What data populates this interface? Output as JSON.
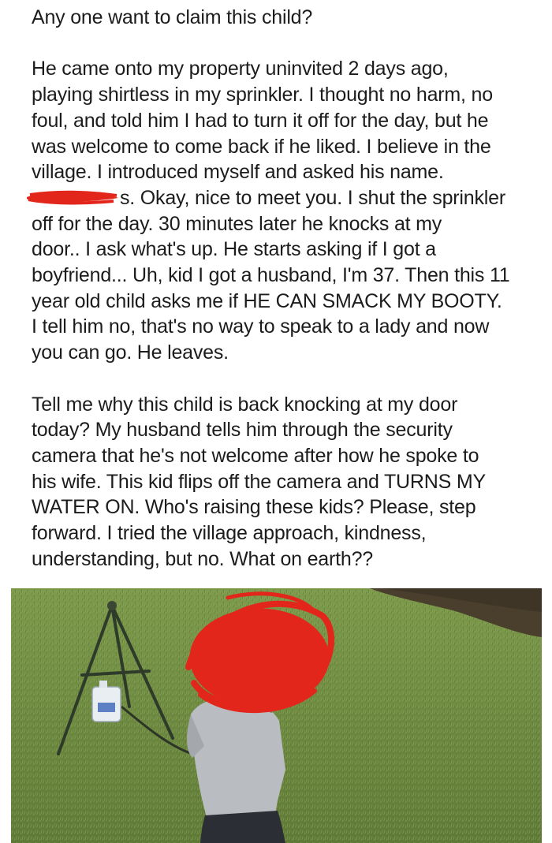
{
  "post": {
    "title": "Any one want to claim this child?",
    "paragraphs": [
      {
        "lines": [
          "He came onto my property uninvited 2  days ago,",
          "playing shirtless in my sprinkler. I thought no harm, no",
          "foul, and told him I had to turn it off for the day, but he",
          "was welcome to come back if he liked. I believe in the",
          "village. I introduced myself and asked his name.",
          "s. Okay, nice to meet you. I shut the sprinkler",
          "off for the day. 30 minutes later he knocks at my",
          "door.. I ask what's up. He starts asking if I got a",
          "boyfriend... Uh, kid I got a husband, I'm 37. Then this 11",
          "year old child asks me if HE CAN SMACK MY BOOTY.",
          "I tell him no, that's no way to speak to a lady and now",
          "you can go. He leaves."
        ]
      },
      {
        "lines": [
          "Tell me why this child is back knocking at my door",
          "today? My husband tells him through the security",
          "camera that he's not welcome after how he spoke to",
          "his wife. This kid flips off the camera and TURNS MY",
          "WATER ON. Who's raising these kids? Please, step",
          "forward. I tried the village approach, kindness,",
          "understanding, but no. What on earth??"
        ]
      }
    ]
  },
  "colors": {
    "text": "#1c1c1c",
    "grass": "#6f8a43",
    "redaction": "#e3261b"
  },
  "photo": {
    "description_icon": "photo-of-child-in-yard"
  }
}
